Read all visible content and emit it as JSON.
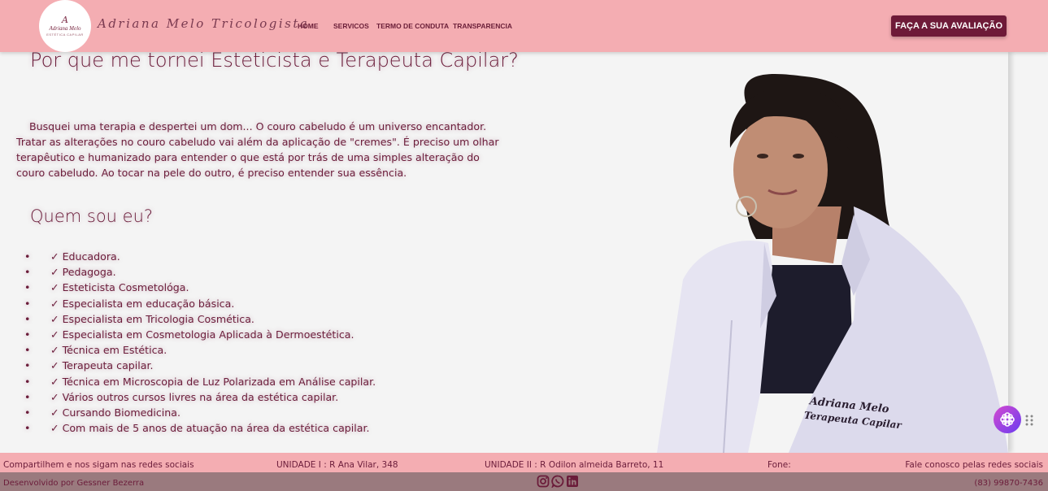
{
  "header": {
    "logo": {
      "mark": "A",
      "name": "Adriana Melo",
      "tagline": "ESTÉTICA CAPILAR"
    },
    "brand_name": "Adriana Melo Tricologista",
    "nav": [
      {
        "label": "HOME"
      },
      {
        "label": "SERVICOS"
      },
      {
        "label": "TERMO DE CONDUTA"
      },
      {
        "label": "TRANSPARENCIA"
      }
    ],
    "cta_label": "FAÇA A SUA AVALIAÇÃO"
  },
  "main": {
    "title": "Por que me tornei Esteticista e Terapeuta Capilar?",
    "paragraph": "Busquei uma terapia e despertei um dom... O couro cabeludo é um universo encantador. Tratar as alterações no couro cabeludo vai além da aplicação de \"cremes\". É preciso um olhar terapêutico e humanizado para entender o que está por trás de uma simples alteração do couro cabeludo. Ao tocar na pele do outro, é preciso entender sua essência.",
    "subtitle": "Quem sou eu?",
    "check": "✓",
    "items": [
      "Educadora.",
      "Pedagoga.",
      "Esteticista Cosmetológa.",
      "Especialista em educação básica.",
      "Especialista em Tricologia Cosmética.",
      "Especialista em Cosmetologia Aplicada à Dermoestética.",
      "Técnica em Estética.",
      "Terapeuta capilar.",
      "Técnica em Microscopia de Luz Polarizada em Análise capilar.",
      "Vários outros cursos livres na área da estética capilar.",
      "Cursando Biomedicina.",
      "Com mais de 5 anos de atuação na área da estética capilar."
    ],
    "photo_badge": {
      "line1": "Adriana Melo",
      "line2": "Terapeuta Capilar"
    }
  },
  "footer": {
    "share": "Compartilhem e nos sigam nas redes sociais",
    "unit1": "UNIDADE I : R Ana Vilar, 348",
    "unit2": "UNIDADE II : R Odilon almeida Barreto, 11",
    "phone_label": "Fone:",
    "social_text": "Fale conosco pelas redes sociais",
    "credit": "Desenvolvido por Gessner Bezerra",
    "phone": "(83) 99870-7436",
    "social_icons": [
      "instagram-icon",
      "whatsapp-icon",
      "linkedin-icon"
    ]
  },
  "colors": {
    "header_bg": "#f4adb2",
    "accent": "#6e1a38",
    "text": "#6b1c3a",
    "footer_bottom": "#9a7a7e"
  }
}
